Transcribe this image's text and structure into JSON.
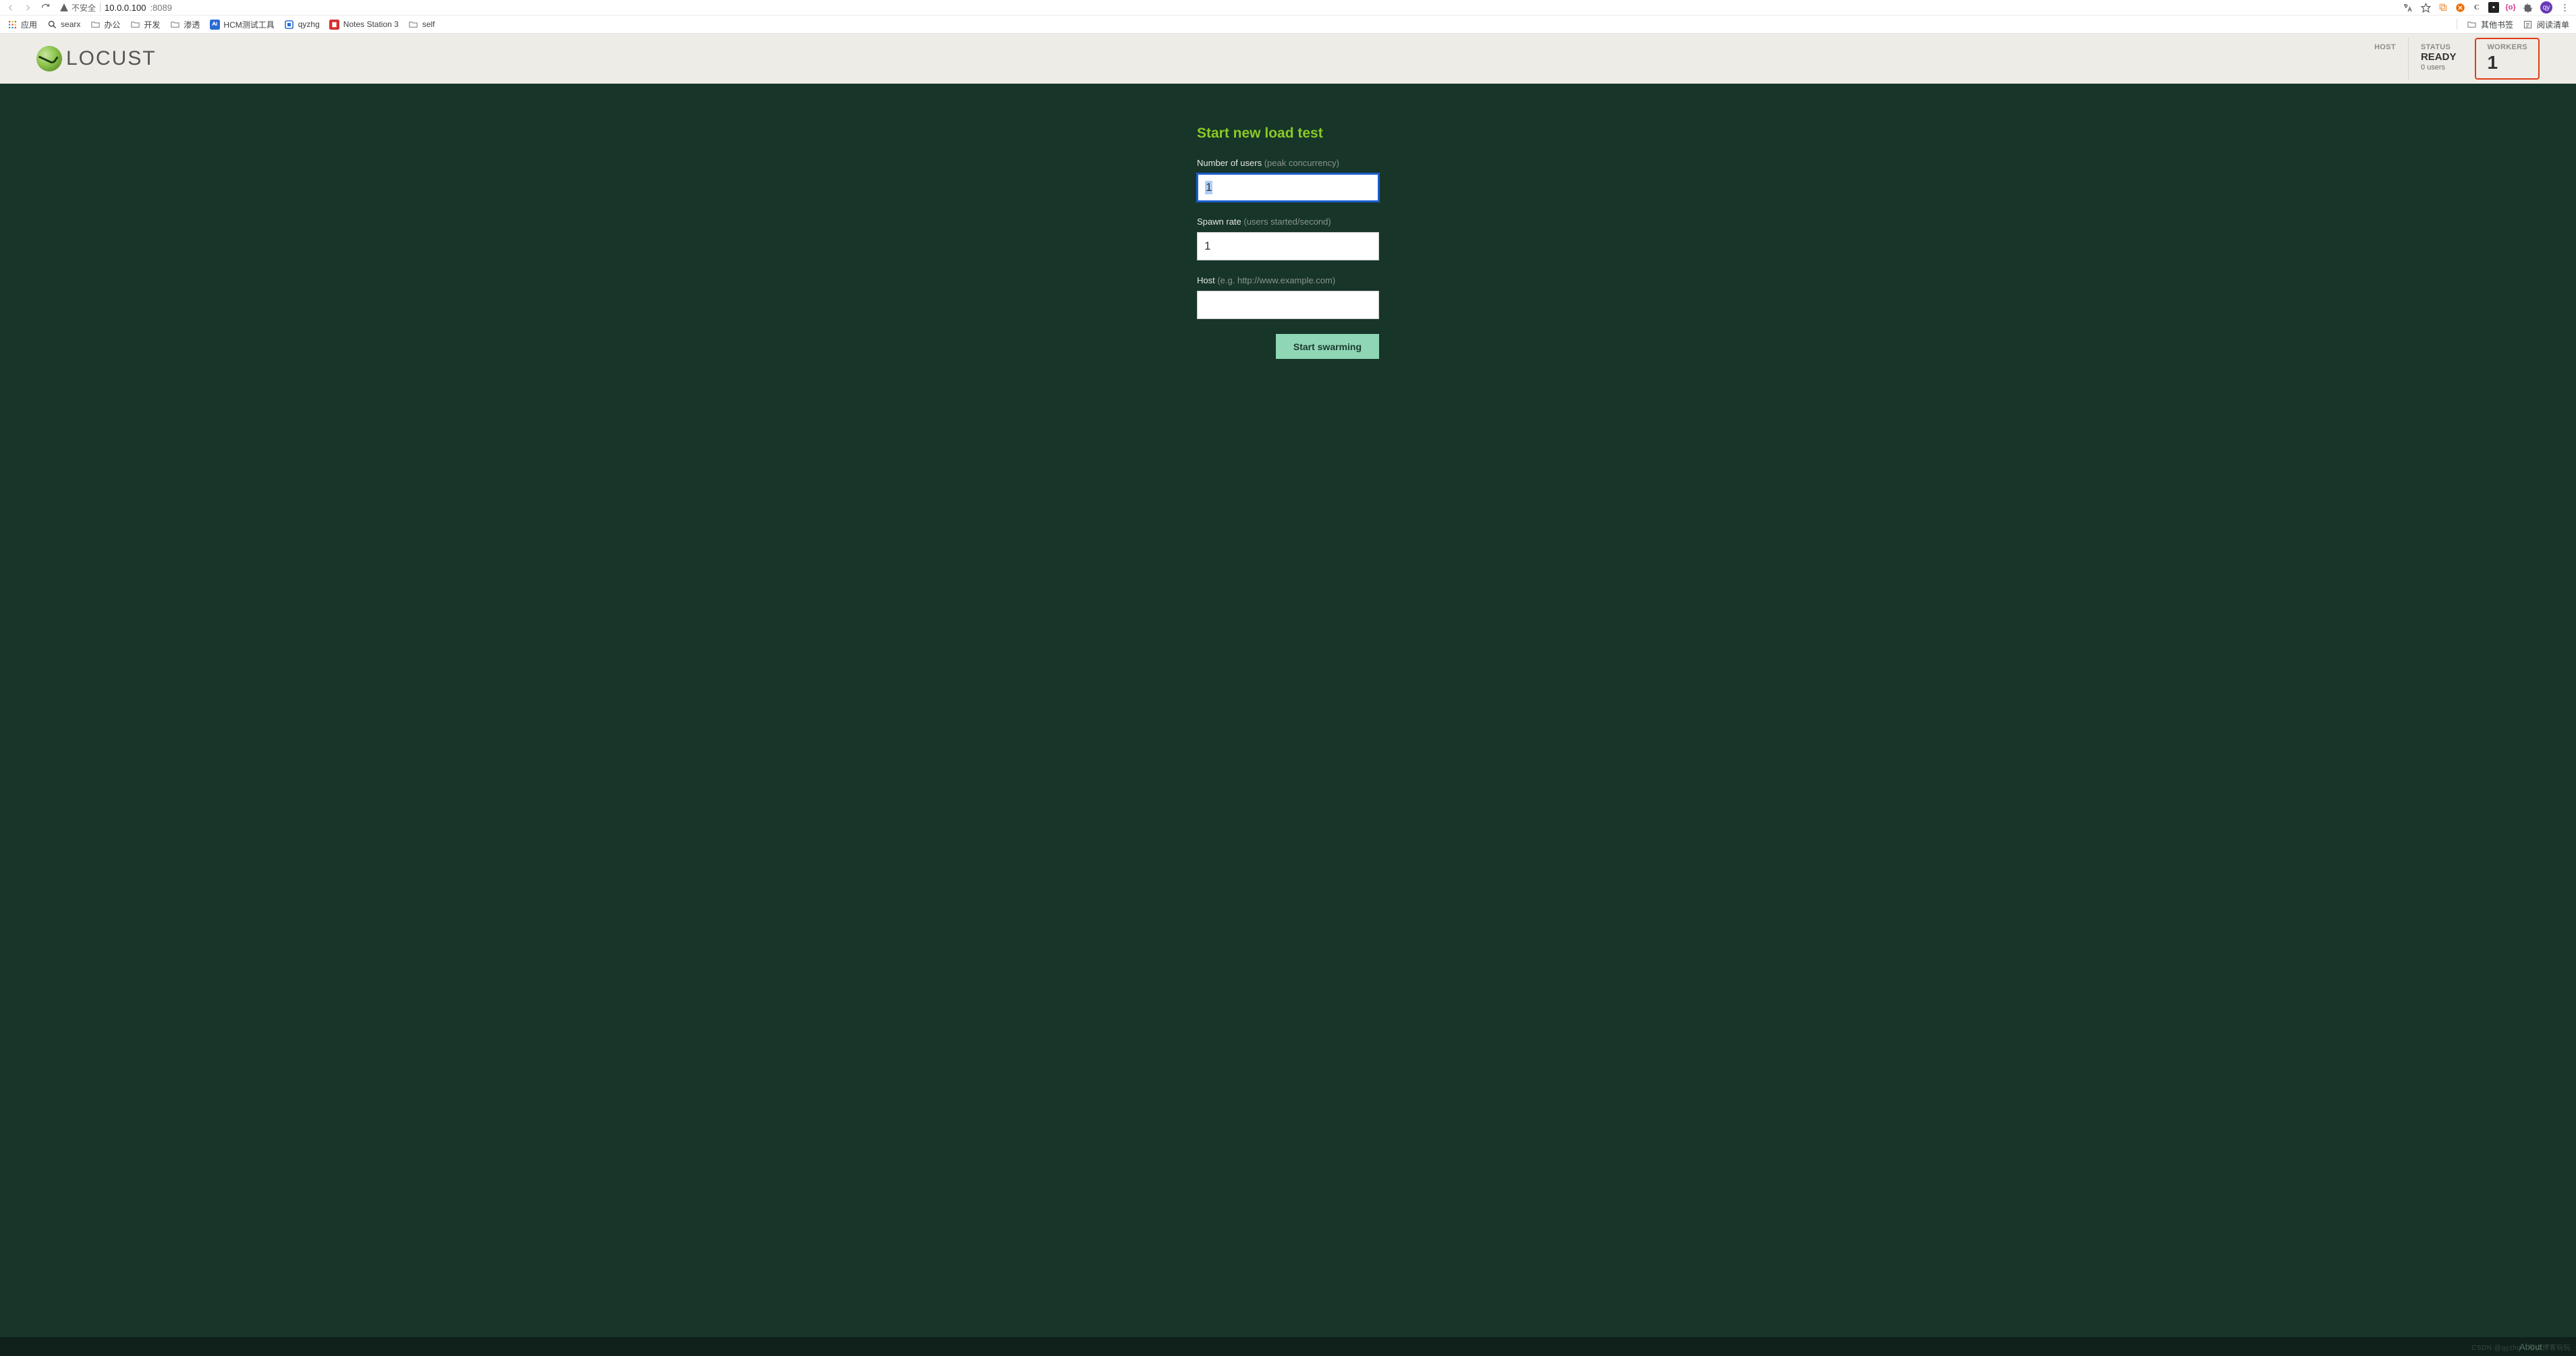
{
  "browser": {
    "insecure_label": "不安全",
    "url_host": "10.0.0.100",
    "url_port": ":8089"
  },
  "bookmarks": {
    "apps": "应用",
    "items": [
      {
        "label": "searx",
        "icon": "search"
      },
      {
        "label": "办公",
        "icon": "folder"
      },
      {
        "label": "开发",
        "icon": "folder"
      },
      {
        "label": "渗透",
        "icon": "folder"
      },
      {
        "label": "HCM测试工具",
        "icon": "app-blue"
      },
      {
        "label": "qyzhg",
        "icon": "app-box"
      },
      {
        "label": "Notes Station 3",
        "icon": "app-red"
      },
      {
        "label": "self",
        "icon": "folder"
      }
    ],
    "other": "其他书签",
    "reading": "阅读清单"
  },
  "header": {
    "logo_text": "LOCUST",
    "stats": {
      "host": {
        "label": "HOST",
        "value": ""
      },
      "status": {
        "label": "STATUS",
        "value": "READY",
        "sub": "0 users"
      },
      "workers": {
        "label": "WORKERS",
        "value": "1"
      }
    }
  },
  "form": {
    "title": "Start new load test",
    "users": {
      "label": "Number of users ",
      "hint": "(peak concurrency)",
      "value": "1"
    },
    "spawn": {
      "label": "Spawn rate ",
      "hint": "(users started/second)",
      "value": "1"
    },
    "host": {
      "label": "Host ",
      "hint": "(e.g. http://www.example.com)",
      "value": ""
    },
    "submit": "Start swarming"
  },
  "footer": {
    "about": "About"
  },
  "watermark": "CSDN @qyzhg · 写点博客玩玩"
}
